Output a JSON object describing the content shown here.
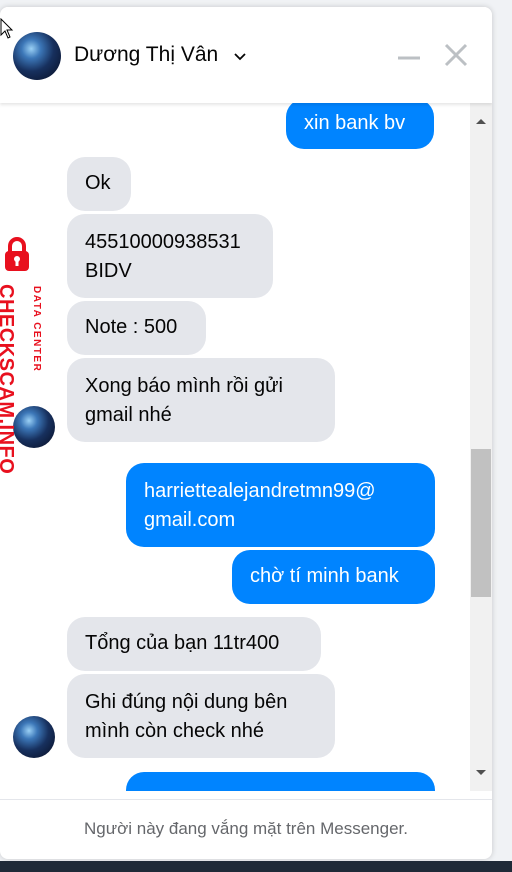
{
  "header": {
    "contact_name": "Dương Thị Vân"
  },
  "messages": [
    {
      "side": "out",
      "lines": [
        "xin bank bv"
      ]
    },
    {
      "side": "in",
      "lines": [
        "Ok"
      ]
    },
    {
      "side": "in",
      "lines": [
        "45510000938531",
        "BIDV"
      ]
    },
    {
      "side": "in",
      "lines": [
        "Note : 500"
      ]
    },
    {
      "side": "in",
      "lines": [
        "Xong báo mình rồi gửi",
        "gmail nhé"
      ]
    },
    {
      "side": "out",
      "lines": [
        "harriettealejandretmn99@",
        "gmail.com"
      ]
    },
    {
      "side": "out",
      "lines": [
        "chờ tí minh bank"
      ]
    },
    {
      "side": "in",
      "lines": [
        "Tổng của bạn 11tr400"
      ]
    },
    {
      "side": "in",
      "lines": [
        "Ghi đúng nội dung bên",
        "mình còn check nhé"
      ]
    }
  ],
  "footer": {
    "status_text": "Người này đang vắng mặt trên Messenger."
  },
  "watermark": {
    "main_text": "CHECKSCAM.INFO",
    "sub_text": "DATA CENTER"
  },
  "colors": {
    "outgoing": "#0084ff",
    "incoming": "#e4e6eb",
    "watermark": "#e8101e"
  }
}
